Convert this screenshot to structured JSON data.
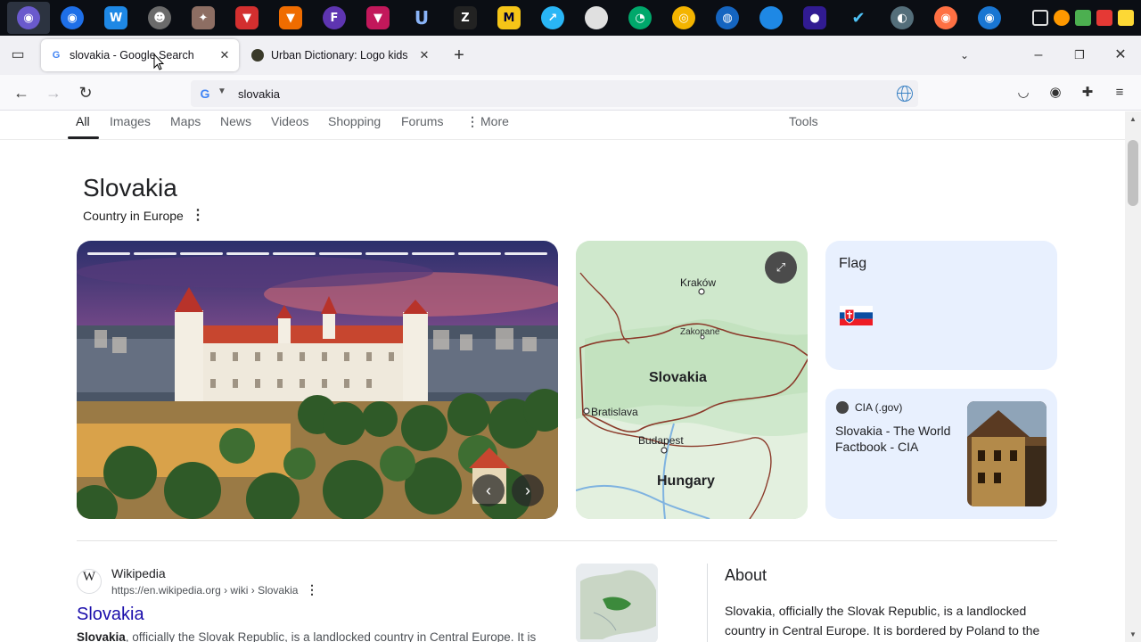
{
  "browser": {
    "tabs": [
      {
        "title": "slovakia - Google Search",
        "favicon": "google-icon",
        "active": true
      },
      {
        "title": "Urban Dictionary: Logo kids",
        "favicon": "urban-dictionary-icon",
        "active": false
      }
    ],
    "url": "slovakia"
  },
  "search_tabs": {
    "all": "All",
    "images": "Images",
    "maps": "Maps",
    "news": "News",
    "videos": "Videos",
    "shopping": "Shopping",
    "forums": "Forums",
    "more": "More",
    "tools": "Tools"
  },
  "knowledge_panel": {
    "title": "Slovakia",
    "subtitle": "Country in Europe",
    "map_labels": {
      "krakow": "Kraków",
      "zakopane": "Zakopane",
      "slovakia": "Slovakia",
      "bratislava": "Bratislava",
      "budapest": "Budapest",
      "hungary": "Hungary"
    },
    "flag_label": "Flag",
    "cia": {
      "source": "CIA (.gov)",
      "title": "Slovakia - The World Factbook - CIA"
    }
  },
  "result": {
    "site_name": "Wikipedia",
    "site_logo": "W",
    "url": "https://en.wikipedia.org › wiki › Slovakia",
    "title": "Slovakia",
    "snippet_bold": "Slovakia",
    "snippet_rest": ", officially the Slovak Republic, is a landlocked country in Central Europe. It is"
  },
  "about": {
    "heading": "About",
    "text": "Slovakia, officially the Slovak Republic, is a landlocked country in Central Europe. It is bordered by Poland to the"
  },
  "colors": {
    "link": "#1a0dab",
    "panel_bg": "#e8f0fe",
    "taskbar": "#0b0e14"
  }
}
